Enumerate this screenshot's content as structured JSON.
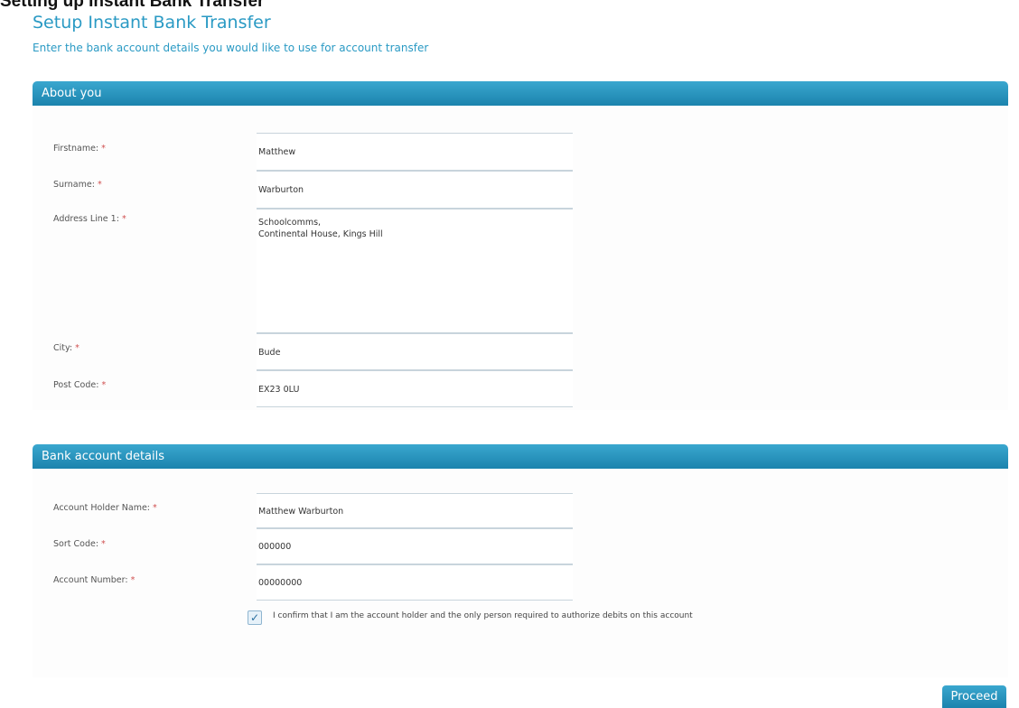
{
  "page": {
    "top_title": "Setting up Instant Bank Transfer",
    "title": "Setup Instant Bank Transfer",
    "subtitle": "Enter the bank account details you would like to use for account transfer"
  },
  "about_you": {
    "header": "About you",
    "fields": {
      "firstname": {
        "label": "Firstname:",
        "value": "Matthew"
      },
      "surname": {
        "label": "Surname:",
        "value": "Warburton"
      },
      "address": {
        "label": "Address Line 1:",
        "value": "Schoolcomms,\nContinental House, Kings Hill"
      },
      "city": {
        "label": "City:",
        "value": "Bude"
      },
      "postcode": {
        "label": "Post Code:",
        "value": "EX23 0LU"
      }
    }
  },
  "bank": {
    "header": "Bank account details",
    "fields": {
      "holder": {
        "label": "Account Holder Name:",
        "value": "Matthew Warburton"
      },
      "sort_code": {
        "label": "Sort Code:",
        "value": "000000"
      },
      "account_number": {
        "label": "Account Number:",
        "value": "00000000"
      }
    },
    "confirm": {
      "checked": true,
      "text": "I confirm that I am the account holder and the only person required to authorize debits on this account"
    }
  },
  "required_marker": "*",
  "proceed_label": "Proceed",
  "colors": {
    "accent": "#2a9ac4",
    "header": "#1b83ad",
    "required": "#d05050"
  }
}
